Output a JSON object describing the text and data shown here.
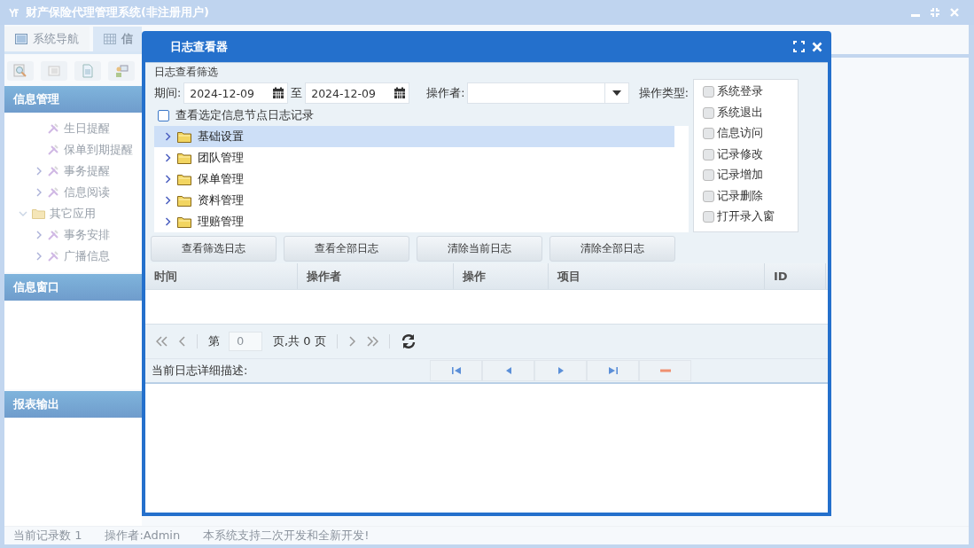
{
  "app": {
    "title": "财产保险代理管理系统(非注册用户)"
  },
  "tabs": [
    {
      "label": "系统导航",
      "selected": false
    },
    {
      "label": "信",
      "selected": true
    }
  ],
  "sidebar": {
    "sections": [
      {
        "title": "信息管理",
        "tree": [
          {
            "kind": "item",
            "label": "生日提醒",
            "expandable": false
          },
          {
            "kind": "item",
            "label": "保单到期提醒",
            "expandable": false
          },
          {
            "kind": "item",
            "label": "事务提醒",
            "expandable": true
          },
          {
            "kind": "item",
            "label": "信息阅读",
            "expandable": true
          },
          {
            "kind": "folder",
            "label": "其它应用",
            "expanded": true,
            "children": [
              {
                "kind": "item",
                "label": "事务安排",
                "expandable": true
              },
              {
                "kind": "item",
                "label": "广播信息",
                "expandable": true
              }
            ]
          }
        ]
      },
      {
        "title": "信息窗口"
      },
      {
        "title": "报表输出"
      }
    ]
  },
  "status_bar": [
    "当前记录数 1",
    "操作者:Admin",
    "本系统支持二次开发和全新开发!"
  ],
  "dialog": {
    "title": "日志查看器",
    "filter": {
      "group_label": "日志查看筛选",
      "period_label": "期间:",
      "from": "2024-12-09",
      "to_label": "至",
      "to": "2024-12-09",
      "operator_label": "操作者:",
      "node_filter": {
        "label": "查看选定信息节点日志记录",
        "checked": false
      },
      "tree": [
        {
          "label": "基础设置",
          "selected": true
        },
        {
          "label": "团队管理",
          "selected": false
        },
        {
          "label": "保单管理",
          "selected": false
        },
        {
          "label": "资料管理",
          "selected": false
        },
        {
          "label": "理赔管理",
          "selected": false
        }
      ],
      "op_type_label": "操作类型:",
      "op_types": [
        {
          "label": "系统登录",
          "checked": false
        },
        {
          "label": "系统退出",
          "checked": false
        },
        {
          "label": "信息访问",
          "checked": false
        },
        {
          "label": "记录修改",
          "checked": false
        },
        {
          "label": "记录增加",
          "checked": false
        },
        {
          "label": "记录删除",
          "checked": false
        },
        {
          "label": "打开录入窗",
          "checked": false
        }
      ]
    },
    "buttons": [
      "查看筛选日志",
      "查看全部日志",
      "清除当前日志",
      "清除全部日志"
    ],
    "columns": [
      "时间",
      "操作者",
      "操作",
      "项目",
      "ID"
    ],
    "pager": {
      "page_label": "第",
      "page": "0",
      "total": "页,共 0 页"
    },
    "detail_label": "当前日志详细描述:"
  }
}
